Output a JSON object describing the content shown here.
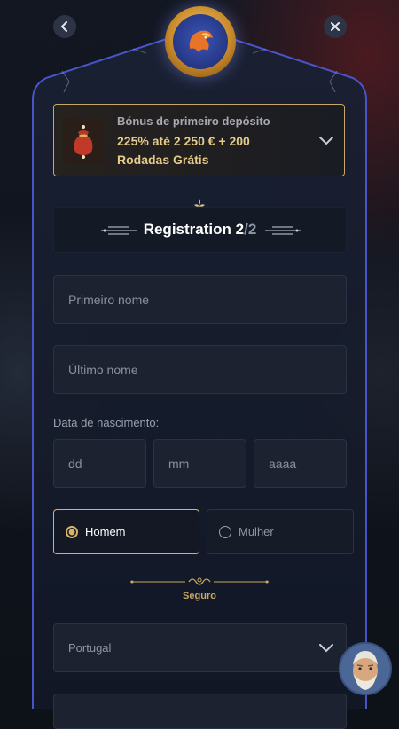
{
  "bonus": {
    "title": "Bónus de primeiro depósito",
    "offer": "225% até 2 250 € + 200 Rodadas Grátis"
  },
  "registration": {
    "title": "Registration",
    "step": "2",
    "separator": "/",
    "total": "2"
  },
  "form": {
    "first_name_placeholder": "Primeiro nome",
    "last_name_placeholder": "Último nome",
    "dob_label": "Data de nascimento:",
    "dob_day_placeholder": "dd",
    "dob_month_placeholder": "mm",
    "dob_year_placeholder": "aaaa",
    "gender_male": "Homem",
    "gender_female": "Mulher",
    "gender_selected": "Homem",
    "secure_label": "Seguro",
    "country": "Portugal"
  },
  "icons": {
    "back": "chevron-left-icon",
    "close": "close-icon",
    "emblem": "dragon-emblem-icon",
    "bonus_thumb": "treasure-bag-icon",
    "bonus_toggle": "chevron-down-icon",
    "country_toggle": "chevron-down-icon",
    "support": "support-avatar-icon"
  },
  "colors": {
    "accent_gold": "#c9a766",
    "offer_gold": "#e6cc8a",
    "panel_border": "#4a55c8",
    "field_bg": "#1c2230"
  }
}
